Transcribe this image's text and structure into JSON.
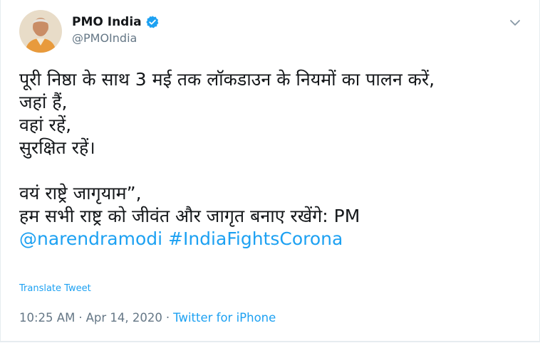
{
  "author": {
    "display_name": "PMO India",
    "handle": "@PMOIndia",
    "verified": true,
    "avatar": "profile-photo-icon"
  },
  "tweet": {
    "lines": [
      "पूरी निष्ठा के साथ 3 मई तक लॉकडाउन के नियमों का पालन करें,",
      "जहां हैं,",
      "वहां रहें,",
      "सुरक्षित रहें।",
      "",
      "वयं राष्ट्रे जागृयाम”,",
      "हम सभी राष्ट्र को जीवंत और जागृत बनाए रखेंगे: PM"
    ],
    "mention": "@narendramodi",
    "hashtag": "#IndiaFightsCorona"
  },
  "translate_label": "Translate Tweet",
  "meta": {
    "time": "10:25 AM",
    "date": "Apr 14, 2020",
    "separator": "·",
    "source": "Twitter for iPhone"
  },
  "colors": {
    "link": "#1da1f2",
    "text": "#14171a",
    "secondary": "#657786",
    "verified_badge": "#1da1f2"
  }
}
